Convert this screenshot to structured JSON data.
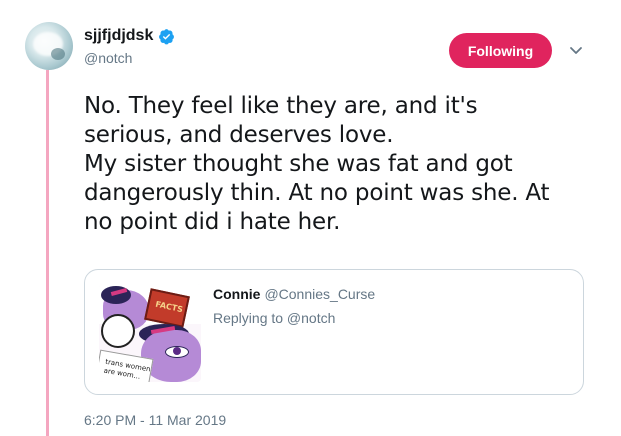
{
  "author": {
    "display_name": "sjjfjdjdsk",
    "handle": "@notch",
    "verified": true,
    "avatar_icon": "avatar-image"
  },
  "follow_button": {
    "label": "Following",
    "color": "#e0245e"
  },
  "menu": {
    "icon": "chevron-down-icon"
  },
  "tweet": {
    "lines": [
      "No. They feel like they are, and it's",
      "serious, and deserves love.",
      "My sister thought she was fat and got",
      "dangerously thin. At no point was she. At",
      "no point did i hate her."
    ],
    "timestamp": "6:20 PM - 11 Mar 2019"
  },
  "quoted_tweet": {
    "display_name": "Connie",
    "handle": "@Connies_Curse",
    "replying_to": "Replying to @notch",
    "image": {
      "book_label": "FACTS",
      "paper_text_line1": "trans women",
      "paper_text_line2": "are wom..."
    }
  },
  "colors": {
    "thread_line": "#f4a6c0",
    "secondary_text": "#657786",
    "verified_blue": "#1da1f2"
  }
}
